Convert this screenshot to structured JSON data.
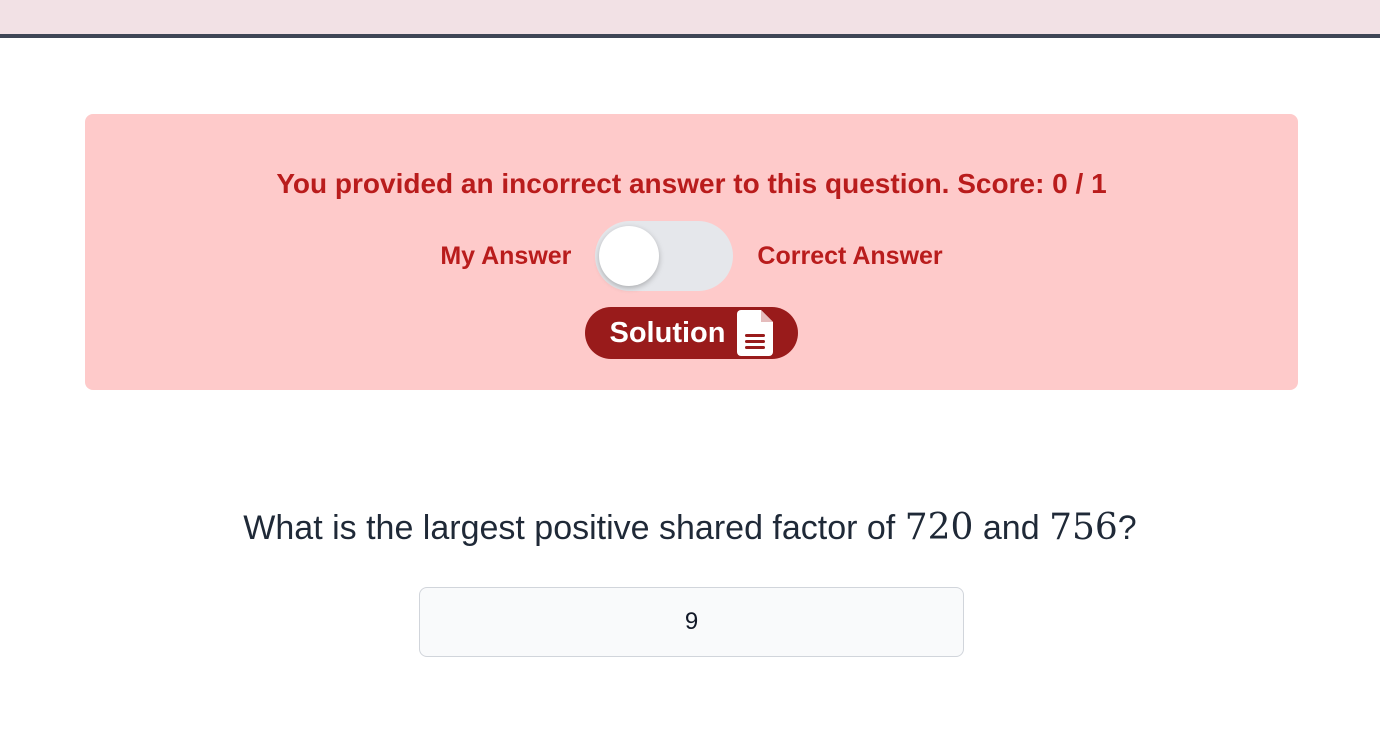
{
  "feedback": {
    "message": "You provided an incorrect answer to this question. Score: 0 / 1",
    "toggle_left_label": "My Answer",
    "toggle_right_label": "Correct Answer",
    "toggle_state": "my-answer",
    "solution_label": "Solution"
  },
  "question": {
    "text_before": "What is the largest positive shared factor of ",
    "num1": "720",
    "text_middle": " and ",
    "num2": "756",
    "text_after": "?"
  },
  "answer": {
    "value": "9"
  },
  "colors": {
    "feedback_bg": "#fecaca",
    "feedback_text": "#b91c1c",
    "solution_bg": "#991b1b",
    "topbar_bg": "#f2e1e5"
  }
}
